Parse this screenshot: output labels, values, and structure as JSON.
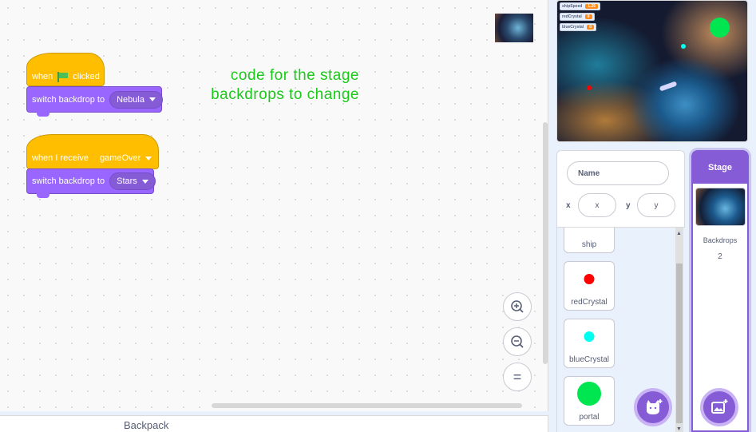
{
  "code": {
    "script1": {
      "hat_when": "when",
      "hat_clicked": "clicked",
      "switch_label": "switch backdrop to",
      "switch_value": "Nebula"
    },
    "script2": {
      "hat_label": "when I receive",
      "hat_value": "gameOver",
      "switch_label": "switch backdrop to",
      "switch_value": "Stars"
    },
    "comment_line1": "code for the stage",
    "comment_line2": "backdrops to change",
    "zoom_reset_symbol": "="
  },
  "backpack": {
    "label": "Backpack"
  },
  "stage": {
    "monitors": [
      {
        "name": "shipSpeed",
        "value": "1.25"
      },
      {
        "name": "redCrystal",
        "value": "0"
      },
      {
        "name": "blueCrystal",
        "value": "0"
      }
    ]
  },
  "sprite_info": {
    "name_placeholder": "Name",
    "x_label": "x",
    "x_placeholder": "x",
    "y_label": "y",
    "y_placeholder": "y"
  },
  "sprites": [
    {
      "name": "ship"
    },
    {
      "name": "redCrystal",
      "color": "#ff0000"
    },
    {
      "name": "blueCrystal",
      "color": "#00ffee"
    },
    {
      "name": "portal",
      "color": "#00e650"
    }
  ],
  "stage_pane": {
    "title": "Stage",
    "backdrops_label": "Backdrops",
    "backdrops_count": "2"
  },
  "colors": {
    "events": "#ffbf00",
    "looks": "#9966ff",
    "accent": "#855cd6",
    "comment": "#1bc91b"
  }
}
